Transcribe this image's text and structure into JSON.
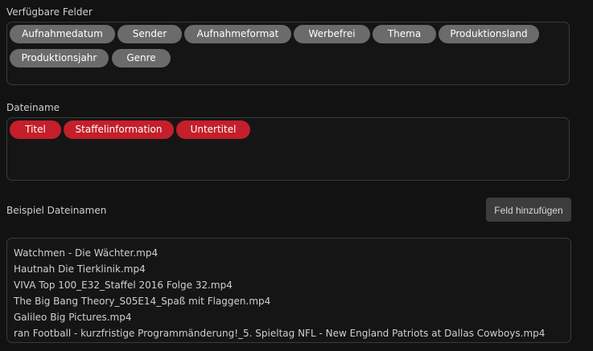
{
  "available_fields": {
    "label": "Verfügbare Felder",
    "chips": [
      {
        "label": "Aufnahmedatum"
      },
      {
        "label": "Sender"
      },
      {
        "label": "Aufnahmeformat"
      },
      {
        "label": "Werbefrei"
      },
      {
        "label": "Thema"
      },
      {
        "label": "Produktionsland"
      },
      {
        "label": "Produktionsjahr"
      },
      {
        "label": "Genre"
      }
    ]
  },
  "filename": {
    "label": "Dateiname",
    "chips": [
      {
        "label": "Titel"
      },
      {
        "label": "Staffelinformation"
      },
      {
        "label": "Untertitel"
      }
    ]
  },
  "examples": {
    "label": "Beispiel Dateinamen",
    "add_button_label": "Feld hinzufügen",
    "lines": [
      "Watchmen - Die Wächter.mp4",
      "Hautnah Die Tierklinik.mp4",
      "VIVA Top 100_E32_Staffel 2016 Folge 32.mp4",
      "The Big Bang Theory_S05E14_Spaß mit Flaggen.mp4",
      "Galileo Big Pictures.mp4",
      "ran Football - kurzfristige Programmänderung!_5. Spieltag NFL - New England Patriots at Dallas Cowboys.mp4"
    ]
  },
  "colors": {
    "chip_available": "#6b6b6b",
    "chip_selected": "#c41f2b",
    "background": "#121212"
  }
}
